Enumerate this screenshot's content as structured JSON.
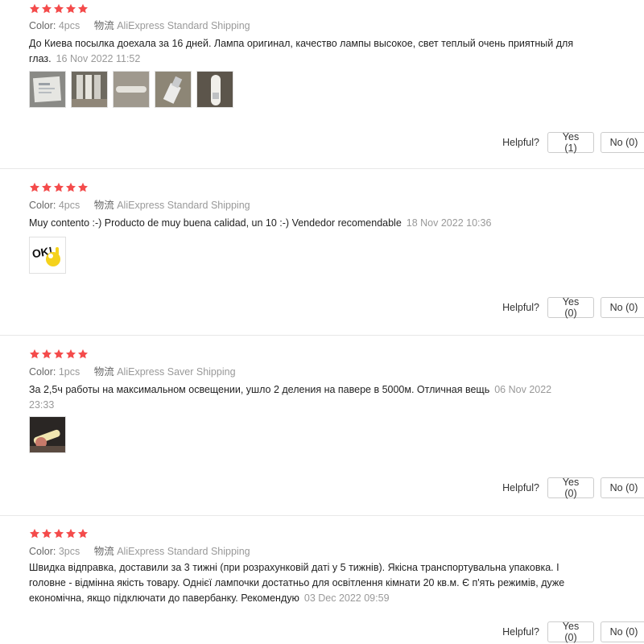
{
  "labels": {
    "color": "Color:",
    "shipping": "物流",
    "helpful": "Helpful?"
  },
  "colors": {
    "star": "#f44b4b",
    "muted": "#999999"
  },
  "reviews": [
    {
      "rating": 5,
      "color": "4pcs",
      "shipping": "AliExpress Standard Shipping",
      "text": "До Киева посылка доехала за 16 дней. Лампа оригинал, качество лампы высокое, свет теплый очень приятный для глаз.",
      "date": "16 Nov 2022 11:52",
      "photos": [
        "package-photo",
        "lamps-photo",
        "lamp-on-carpet-photo",
        "usb-plug-photo",
        "usb-lamp-photo"
      ],
      "yes": "Yes (1)",
      "no": "No (0)"
    },
    {
      "rating": 5,
      "color": "4pcs",
      "shipping": "AliExpress Standard Shipping",
      "text": "Muy contento :-) Producto de muy buena calidad, un 10 :-) Vendedor recomendable",
      "date": "18 Nov 2022 10:36",
      "photos": [
        "ok-hand-sticker"
      ],
      "yes": "Yes (0)",
      "no": "No (0)"
    },
    {
      "rating": 5,
      "color": "1pcs",
      "shipping": "AliExpress Saver Shipping",
      "text": "За 2,5ч работы на максимальном освещении, ушло 2 деления на павере в 5000м. Отличная вещь",
      "date": "06 Nov 2022 23:33",
      "photos": [
        "lamp-glowing-photo"
      ],
      "yes": "Yes (0)",
      "no": "No (0)"
    },
    {
      "rating": 5,
      "color": "3pcs",
      "shipping": "AliExpress Standard Shipping",
      "text": "Швидка відправка, доставили за 3 тижні (при розрахунковій даті у 5 тижнів). Якісна транспортувальна упаковка. І головне - відмінна якість товару. Однієї лампочки достатньо для освітлення кімнати 20 кв.м. Є п'ять режимів, дуже економічна, якщо підключати до павербанку. Рекомендую",
      "date": "03 Dec 2022 09:59",
      "photos": [],
      "yes": "Yes (0)",
      "no": "No (0)"
    }
  ]
}
